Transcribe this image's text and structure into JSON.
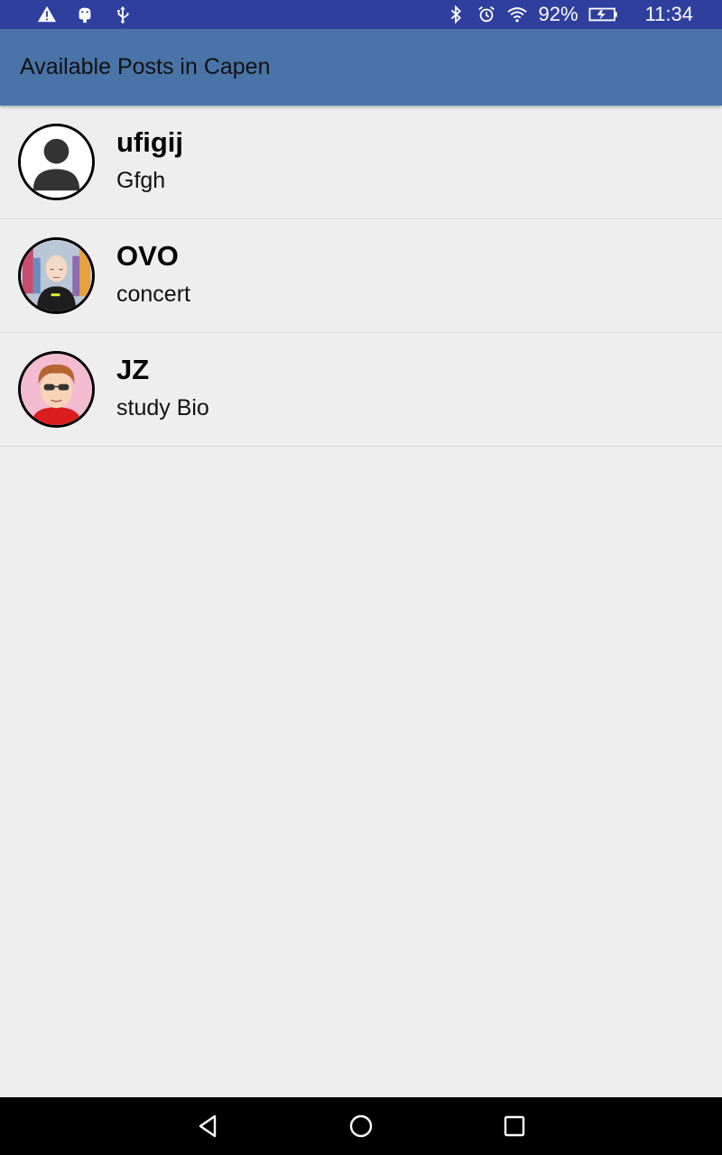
{
  "status_bar": {
    "icons_left": [
      "warning-icon",
      "android-icon",
      "usb-icon"
    ],
    "icons_right": [
      "bluetooth-icon",
      "alarm-icon",
      "wifi-icon"
    ],
    "battery_percent": "92%",
    "battery_level": 0.92,
    "time": "11:34"
  },
  "app_bar": {
    "title": "Available Posts in Capen",
    "color": "#4a73a8"
  },
  "posts": [
    {
      "name": "ufigij",
      "description": "Gfgh",
      "avatar": "default-person-avatar"
    },
    {
      "name": "OVO",
      "description": "concert",
      "avatar": "bald-man-avatar"
    },
    {
      "name": "JZ",
      "description": "study Bio",
      "avatar": "sunglasses-man-avatar"
    }
  ],
  "nav_bar": {
    "buttons": [
      "back-icon",
      "home-icon",
      "recents-icon"
    ]
  },
  "colors": {
    "status_bar": "#2f3f9e",
    "background": "#eeeeee"
  }
}
